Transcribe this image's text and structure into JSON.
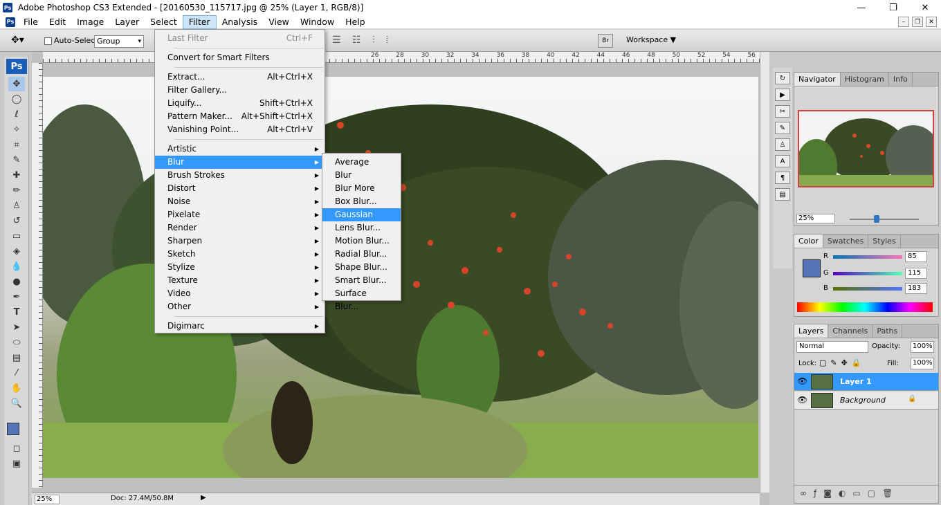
{
  "app": {
    "title": "Adobe Photoshop CS3 Extended - [20160530_115717.jpg @ 25% (Layer 1, RGB/8)]",
    "logo": "Ps"
  },
  "window_controls": {
    "minimize": "—",
    "maximize": "❐",
    "close": "✕"
  },
  "doc_controls": {
    "minimize": "–",
    "restore": "❐",
    "close": "✕"
  },
  "menubar": [
    "File",
    "Edit",
    "Image",
    "Layer",
    "Select",
    "Filter",
    "Analysis",
    "View",
    "Window",
    "Help"
  ],
  "options": {
    "auto_select_label": "Auto-Select:",
    "auto_select_value": "Group",
    "workspace_label": "Workspace ▼"
  },
  "toolbox": {
    "badge": "Ps"
  },
  "ruler": {
    "h_ticks": [
      "26",
      "28",
      "30",
      "32",
      "34",
      "36",
      "38",
      "40",
      "42",
      "44",
      "46",
      "48",
      "50",
      "52",
      "54",
      "56",
      "0"
    ]
  },
  "filter_menu": [
    {
      "label": "Last Filter",
      "shortcut": "Ctrl+F",
      "disabled": true
    },
    {
      "sep": true
    },
    {
      "label": "Convert for Smart Filters"
    },
    {
      "sep": true
    },
    {
      "label": "Extract...",
      "shortcut": "Alt+Ctrl+X"
    },
    {
      "label": "Filter Gallery..."
    },
    {
      "label": "Liquify...",
      "shortcut": "Shift+Ctrl+X"
    },
    {
      "label": "Pattern Maker...",
      "shortcut": "Alt+Shift+Ctrl+X"
    },
    {
      "label": "Vanishing Point...",
      "shortcut": "Alt+Ctrl+V"
    },
    {
      "sep": true
    },
    {
      "label": "Artistic",
      "submenu": true
    },
    {
      "label": "Blur",
      "submenu": true,
      "highlighted": true
    },
    {
      "label": "Brush Strokes",
      "submenu": true
    },
    {
      "label": "Distort",
      "submenu": true
    },
    {
      "label": "Noise",
      "submenu": true
    },
    {
      "label": "Pixelate",
      "submenu": true
    },
    {
      "label": "Render",
      "submenu": true
    },
    {
      "label": "Sharpen",
      "submenu": true
    },
    {
      "label": "Sketch",
      "submenu": true
    },
    {
      "label": "Stylize",
      "submenu": true
    },
    {
      "label": "Texture",
      "submenu": true
    },
    {
      "label": "Video",
      "submenu": true
    },
    {
      "label": "Other",
      "submenu": true
    },
    {
      "sep": true
    },
    {
      "label": "Digimarc",
      "submenu": true
    }
  ],
  "blur_submenu": [
    {
      "label": "Average"
    },
    {
      "label": "Blur"
    },
    {
      "label": "Blur More"
    },
    {
      "label": "Box Blur..."
    },
    {
      "label": "Gaussian Blur...",
      "highlighted": true
    },
    {
      "label": "Lens Blur..."
    },
    {
      "label": "Motion Blur..."
    },
    {
      "label": "Radial Blur..."
    },
    {
      "label": "Shape Blur..."
    },
    {
      "label": "Smart Blur..."
    },
    {
      "label": "Surface Blur..."
    }
  ],
  "status": {
    "zoom": "25%",
    "doc": "Doc: 27.4M/50.8M"
  },
  "navigator": {
    "tabs": [
      "Navigator",
      "Histogram",
      "Info"
    ],
    "zoom": "25%"
  },
  "color": {
    "tabs": [
      "Color",
      "Swatches",
      "Styles"
    ],
    "r": "85",
    "g": "115",
    "b": "183",
    "fg_color": "#5573b7"
  },
  "layers": {
    "tabs": [
      "Layers",
      "Channels",
      "Paths"
    ],
    "blend_mode": "Normal",
    "opacity_label": "Opacity:",
    "opacity": "100%",
    "lock_label": "Lock:",
    "fill_label": "Fill:",
    "fill": "100%",
    "items": [
      {
        "name": "Layer 1",
        "selected": true
      },
      {
        "name": "Background",
        "selected": false
      }
    ]
  }
}
